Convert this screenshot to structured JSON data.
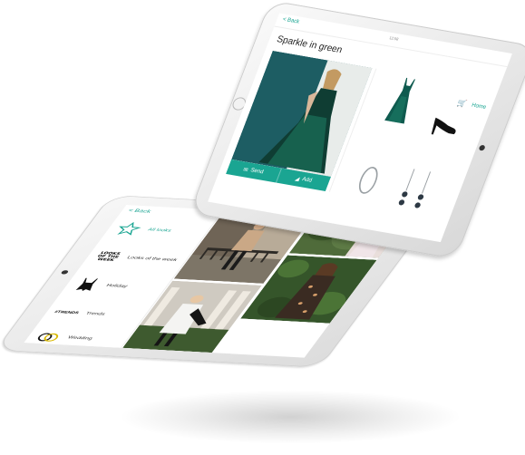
{
  "colors": {
    "accent": "#1aa592",
    "dress_green": "#0f5b4f"
  },
  "back_tablet": {
    "back_label": "< Back",
    "categories": [
      {
        "label": "All looks",
        "icon": "star-icon",
        "active": true
      },
      {
        "label": "Looks of the week",
        "icon": "looks-of-the-week-icon",
        "badge_lines": [
          "LOOKS",
          "OF THE",
          "WEEK"
        ]
      },
      {
        "label": "Holiday",
        "icon": "swimsuit-icon"
      },
      {
        "label": "Trends",
        "icon": "trends-icon",
        "badge": "#TRENDS"
      },
      {
        "label": "Wedding",
        "icon": "rings-icon"
      }
    ]
  },
  "front_tablet": {
    "back_label": "< Back",
    "status_text": "12:58",
    "title": "Sparkle in green",
    "home_label": "Home",
    "cart_icon": "cart-icon",
    "actions": [
      {
        "label": "Send",
        "icon": "envelope-icon"
      },
      {
        "label": "Add",
        "icon": "hanger-icon"
      }
    ],
    "products": [
      "sequin-dress",
      "black-pump",
      "silver-bangle",
      "drop-earrings"
    ]
  }
}
